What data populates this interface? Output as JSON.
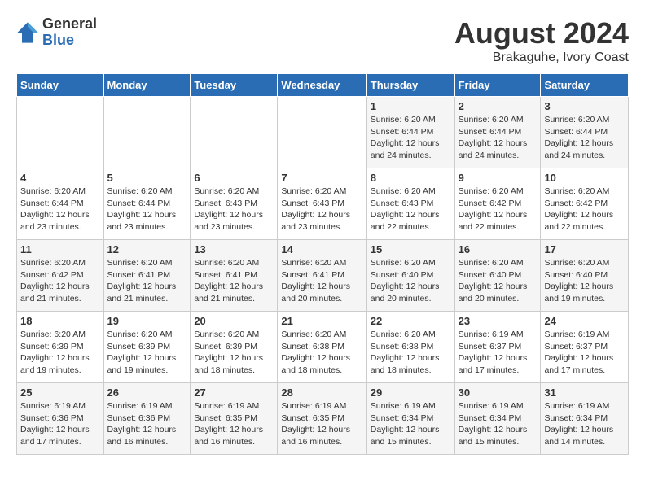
{
  "header": {
    "logo_general": "General",
    "logo_blue": "Blue",
    "month_year": "August 2024",
    "location": "Brakaguhe, Ivory Coast"
  },
  "days_of_week": [
    "Sunday",
    "Monday",
    "Tuesday",
    "Wednesday",
    "Thursday",
    "Friday",
    "Saturday"
  ],
  "weeks": [
    [
      {
        "day": "",
        "info": ""
      },
      {
        "day": "",
        "info": ""
      },
      {
        "day": "",
        "info": ""
      },
      {
        "day": "",
        "info": ""
      },
      {
        "day": "1",
        "info": "Sunrise: 6:20 AM\nSunset: 6:44 PM\nDaylight: 12 hours\nand 24 minutes."
      },
      {
        "day": "2",
        "info": "Sunrise: 6:20 AM\nSunset: 6:44 PM\nDaylight: 12 hours\nand 24 minutes."
      },
      {
        "day": "3",
        "info": "Sunrise: 6:20 AM\nSunset: 6:44 PM\nDaylight: 12 hours\nand 24 minutes."
      }
    ],
    [
      {
        "day": "4",
        "info": "Sunrise: 6:20 AM\nSunset: 6:44 PM\nDaylight: 12 hours\nand 23 minutes."
      },
      {
        "day": "5",
        "info": "Sunrise: 6:20 AM\nSunset: 6:44 PM\nDaylight: 12 hours\nand 23 minutes."
      },
      {
        "day": "6",
        "info": "Sunrise: 6:20 AM\nSunset: 6:43 PM\nDaylight: 12 hours\nand 23 minutes."
      },
      {
        "day": "7",
        "info": "Sunrise: 6:20 AM\nSunset: 6:43 PM\nDaylight: 12 hours\nand 23 minutes."
      },
      {
        "day": "8",
        "info": "Sunrise: 6:20 AM\nSunset: 6:43 PM\nDaylight: 12 hours\nand 22 minutes."
      },
      {
        "day": "9",
        "info": "Sunrise: 6:20 AM\nSunset: 6:42 PM\nDaylight: 12 hours\nand 22 minutes."
      },
      {
        "day": "10",
        "info": "Sunrise: 6:20 AM\nSunset: 6:42 PM\nDaylight: 12 hours\nand 22 minutes."
      }
    ],
    [
      {
        "day": "11",
        "info": "Sunrise: 6:20 AM\nSunset: 6:42 PM\nDaylight: 12 hours\nand 21 minutes."
      },
      {
        "day": "12",
        "info": "Sunrise: 6:20 AM\nSunset: 6:41 PM\nDaylight: 12 hours\nand 21 minutes."
      },
      {
        "day": "13",
        "info": "Sunrise: 6:20 AM\nSunset: 6:41 PM\nDaylight: 12 hours\nand 21 minutes."
      },
      {
        "day": "14",
        "info": "Sunrise: 6:20 AM\nSunset: 6:41 PM\nDaylight: 12 hours\nand 20 minutes."
      },
      {
        "day": "15",
        "info": "Sunrise: 6:20 AM\nSunset: 6:40 PM\nDaylight: 12 hours\nand 20 minutes."
      },
      {
        "day": "16",
        "info": "Sunrise: 6:20 AM\nSunset: 6:40 PM\nDaylight: 12 hours\nand 20 minutes."
      },
      {
        "day": "17",
        "info": "Sunrise: 6:20 AM\nSunset: 6:40 PM\nDaylight: 12 hours\nand 19 minutes."
      }
    ],
    [
      {
        "day": "18",
        "info": "Sunrise: 6:20 AM\nSunset: 6:39 PM\nDaylight: 12 hours\nand 19 minutes."
      },
      {
        "day": "19",
        "info": "Sunrise: 6:20 AM\nSunset: 6:39 PM\nDaylight: 12 hours\nand 19 minutes."
      },
      {
        "day": "20",
        "info": "Sunrise: 6:20 AM\nSunset: 6:39 PM\nDaylight: 12 hours\nand 18 minutes."
      },
      {
        "day": "21",
        "info": "Sunrise: 6:20 AM\nSunset: 6:38 PM\nDaylight: 12 hours\nand 18 minutes."
      },
      {
        "day": "22",
        "info": "Sunrise: 6:20 AM\nSunset: 6:38 PM\nDaylight: 12 hours\nand 18 minutes."
      },
      {
        "day": "23",
        "info": "Sunrise: 6:19 AM\nSunset: 6:37 PM\nDaylight: 12 hours\nand 17 minutes."
      },
      {
        "day": "24",
        "info": "Sunrise: 6:19 AM\nSunset: 6:37 PM\nDaylight: 12 hours\nand 17 minutes."
      }
    ],
    [
      {
        "day": "25",
        "info": "Sunrise: 6:19 AM\nSunset: 6:36 PM\nDaylight: 12 hours\nand 17 minutes."
      },
      {
        "day": "26",
        "info": "Sunrise: 6:19 AM\nSunset: 6:36 PM\nDaylight: 12 hours\nand 16 minutes."
      },
      {
        "day": "27",
        "info": "Sunrise: 6:19 AM\nSunset: 6:35 PM\nDaylight: 12 hours\nand 16 minutes."
      },
      {
        "day": "28",
        "info": "Sunrise: 6:19 AM\nSunset: 6:35 PM\nDaylight: 12 hours\nand 16 minutes."
      },
      {
        "day": "29",
        "info": "Sunrise: 6:19 AM\nSunset: 6:34 PM\nDaylight: 12 hours\nand 15 minutes."
      },
      {
        "day": "30",
        "info": "Sunrise: 6:19 AM\nSunset: 6:34 PM\nDaylight: 12 hours\nand 15 minutes."
      },
      {
        "day": "31",
        "info": "Sunrise: 6:19 AM\nSunset: 6:34 PM\nDaylight: 12 hours\nand 14 minutes."
      }
    ]
  ]
}
